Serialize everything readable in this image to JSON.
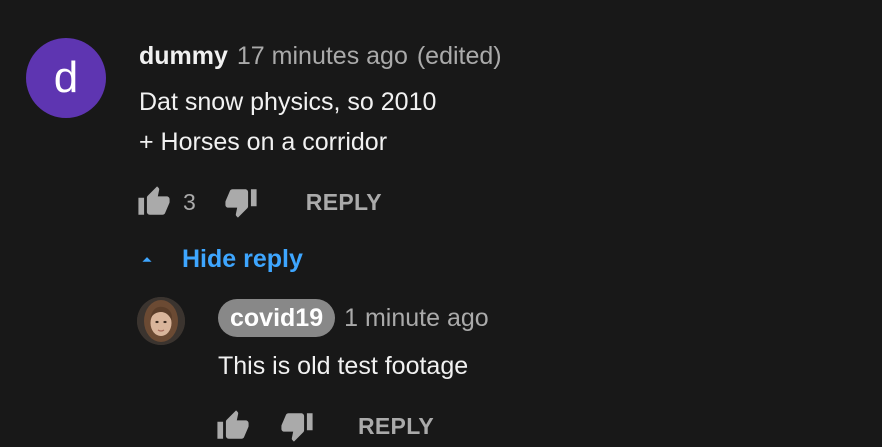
{
  "comment": {
    "author": "dummy",
    "avatar_letter": "d",
    "avatar_color": "#5e35b1",
    "timestamp": "17 minutes ago",
    "edited": "(edited)",
    "lines": [
      "Dat snow physics, so 2010",
      "+ Horses on a corridor"
    ],
    "like_count": "3",
    "reply_label": "REPLY",
    "toggle_replies_label": "Hide reply"
  },
  "reply": {
    "author": "covid19",
    "timestamp": "1 minute ago",
    "text": "This is old test footage",
    "reply_label": "REPLY"
  },
  "colors": {
    "background": "#181818",
    "link_blue": "#3ea6ff",
    "muted": "#aaaaaa",
    "author_chip": "#888888"
  }
}
